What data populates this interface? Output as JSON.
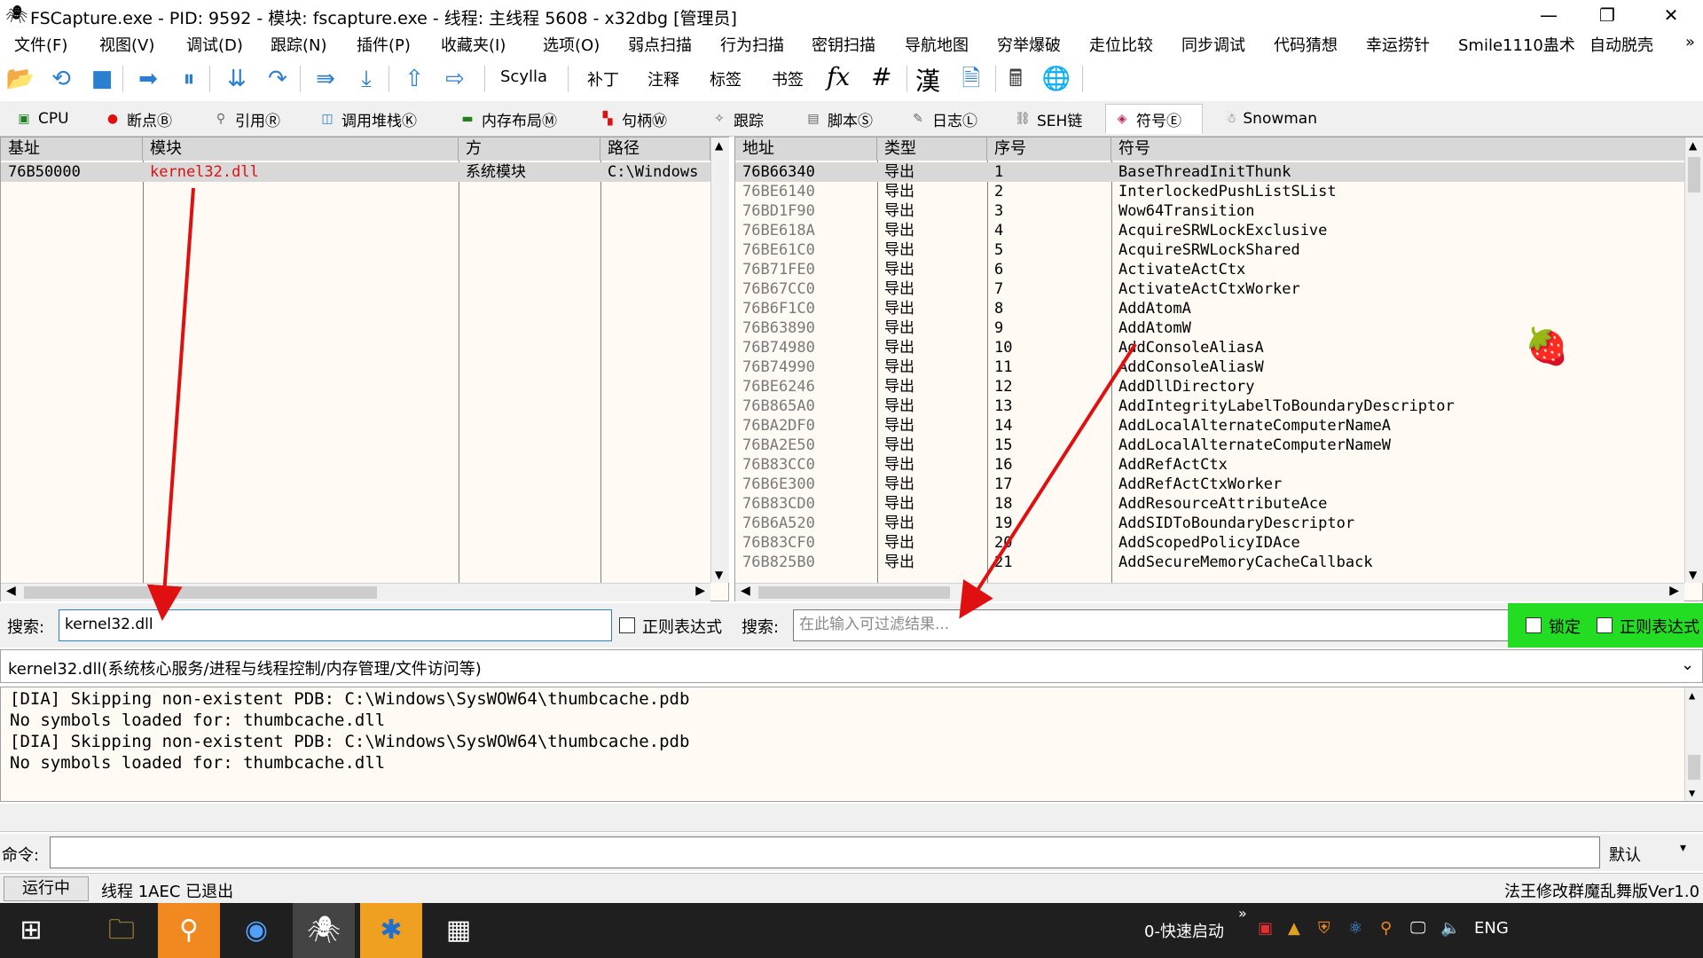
{
  "window": {
    "title": "FSCapture.exe - PID: 9592 - 模块: fscapture.exe - 线程: 主线程 5608 - x32dbg [管理员]",
    "minimize": "—",
    "maximize": "❐",
    "close": "✕"
  },
  "menu": [
    "文件(F)",
    "视图(V)",
    "调试(D)",
    "跟踪(N)",
    "插件(P)",
    "收藏夹(I)",
    "选项(O)",
    "弱点扫描",
    "行为扫描",
    "密钥扫描",
    "导航地图",
    "穷举爆破",
    "走位比较",
    "同步调试",
    "代码猜想",
    "幸运捞针",
    "Smile1110蛊术",
    "自动脱壳",
    "»"
  ],
  "toolbar": {
    "scylla": "Scylla",
    "patch": "补丁",
    "comment": "注释",
    "label": "标签",
    "bookmark": "书签",
    "fx": "fx",
    "hash": "#",
    "han": "漢"
  },
  "tabs": [
    "CPU",
    "断点Ⓑ",
    "引用Ⓡ",
    "调用堆栈Ⓚ",
    "内存布局Ⓜ",
    "句柄Ⓦ",
    "跟踪",
    "脚本Ⓢ",
    "日志Ⓛ",
    "SEH链",
    "符号Ⓔ",
    "Snowman"
  ],
  "modules": {
    "headers": [
      "基址",
      "模块",
      "方",
      "路径"
    ],
    "rows": [
      {
        "base": "76B50000",
        "module": "kernel32.dll",
        "type": "系统模块",
        "path": "C:\\Windows"
      }
    ]
  },
  "symbols": {
    "headers": [
      "地址",
      "类型",
      "序号",
      "符号"
    ],
    "rows": [
      {
        "addr": "76B66340",
        "type": "导出",
        "ord": "1",
        "sym": "BaseThreadInitThunk"
      },
      {
        "addr": "76BE6140",
        "type": "导出",
        "ord": "2",
        "sym": "InterlockedPushListSList"
      },
      {
        "addr": "76BD1F90",
        "type": "导出",
        "ord": "3",
        "sym": "Wow64Transition"
      },
      {
        "addr": "76BE618A",
        "type": "导出",
        "ord": "4",
        "sym": "AcquireSRWLockExclusive"
      },
      {
        "addr": "76BE61C0",
        "type": "导出",
        "ord": "5",
        "sym": "AcquireSRWLockShared"
      },
      {
        "addr": "76B71FE0",
        "type": "导出",
        "ord": "6",
        "sym": "ActivateActCtx"
      },
      {
        "addr": "76B67CC0",
        "type": "导出",
        "ord": "7",
        "sym": "ActivateActCtxWorker"
      },
      {
        "addr": "76B6F1C0",
        "type": "导出",
        "ord": "8",
        "sym": "AddAtomA"
      },
      {
        "addr": "76B63890",
        "type": "导出",
        "ord": "9",
        "sym": "AddAtomW"
      },
      {
        "addr": "76B74980",
        "type": "导出",
        "ord": "10",
        "sym": "AddConsoleAliasA"
      },
      {
        "addr": "76B74990",
        "type": "导出",
        "ord": "11",
        "sym": "AddConsoleAliasW"
      },
      {
        "addr": "76BE6246",
        "type": "导出",
        "ord": "12",
        "sym": "AddDllDirectory"
      },
      {
        "addr": "76B865A0",
        "type": "导出",
        "ord": "13",
        "sym": "AddIntegrityLabelToBoundaryDescriptor"
      },
      {
        "addr": "76BA2DF0",
        "type": "导出",
        "ord": "14",
        "sym": "AddLocalAlternateComputerNameA"
      },
      {
        "addr": "76BA2E50",
        "type": "导出",
        "ord": "15",
        "sym": "AddLocalAlternateComputerNameW"
      },
      {
        "addr": "76B83CC0",
        "type": "导出",
        "ord": "16",
        "sym": "AddRefActCtx"
      },
      {
        "addr": "76B6E300",
        "type": "导出",
        "ord": "17",
        "sym": "AddRefActCtxWorker"
      },
      {
        "addr": "76B83CD0",
        "type": "导出",
        "ord": "18",
        "sym": "AddResourceAttributeAce"
      },
      {
        "addr": "76B6A520",
        "type": "导出",
        "ord": "19",
        "sym": "AddSIDToBoundaryDescriptor"
      },
      {
        "addr": "76B83CF0",
        "type": "导出",
        "ord": "20",
        "sym": "AddScopedPolicyIDAce"
      },
      {
        "addr": "76B825B0",
        "type": "导出",
        "ord": "21",
        "sym": "AddSecureMemoryCacheCallback"
      }
    ]
  },
  "search": {
    "label_left": "搜索:",
    "left_value": "kernel32.dll",
    "regex_label": "正则表达式",
    "label_right": "搜索:",
    "right_placeholder": "在此输入可过滤结果...",
    "lock_label": "锁定",
    "regex_label2": "正则表达式"
  },
  "info_line": "kernel32.dll(系统核心服务/进程与线程控制/内存管理/文件访问等)",
  "log": [
    "[DIA] Skipping non-existent PDB: C:\\Windows\\SysWOW64\\thumbcache.pdb",
    "No symbols loaded for: thumbcache.dll",
    "[DIA] Skipping non-existent PDB: C:\\Windows\\SysWOW64\\thumbcache.pdb",
    "No symbols loaded for: thumbcache.dll"
  ],
  "command": {
    "label": "命令:",
    "value": "",
    "default_label": "默认"
  },
  "status": {
    "state": "运行中",
    "message": "线程 1AEC 已退出",
    "right": "法王修改群魔乱舞版Ver1.0"
  },
  "taskbar": {
    "quick_launch": "0-快速启动",
    "lang": "ENG",
    "chevron": "»"
  },
  "colors": {
    "accent_red": "#e01010",
    "highlight_green": "#22dd22",
    "row_selected": "#d8d8d8",
    "pane_bg": "#fffaf4"
  }
}
